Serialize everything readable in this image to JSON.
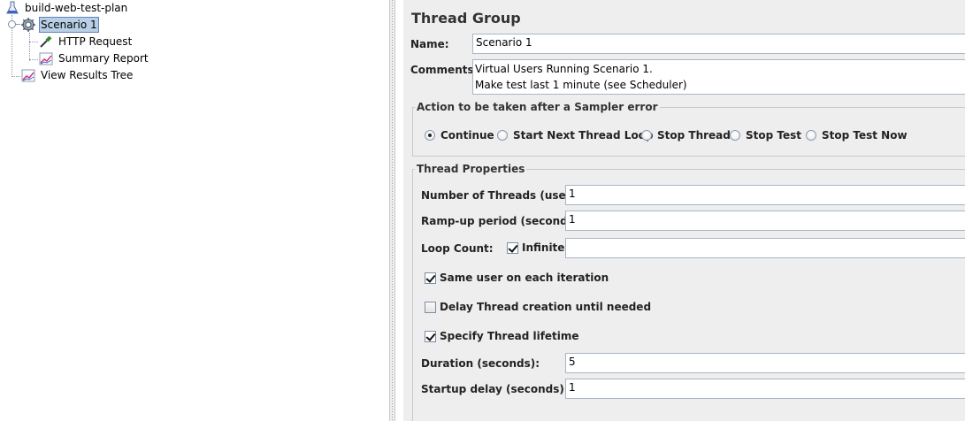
{
  "tree": {
    "root": {
      "label": "build-web-test-plan",
      "icon": "flask-icon"
    },
    "items": [
      {
        "label": "Scenario 1",
        "icon": "gear-icon",
        "selected": true
      },
      {
        "label": "HTTP Request",
        "icon": "pipette-icon"
      },
      {
        "label": "Summary Report",
        "icon": "chart-icon"
      },
      {
        "label": "View Results Tree",
        "icon": "chart-icon"
      }
    ]
  },
  "panel": {
    "title": "Thread Group",
    "name_label": "Name:",
    "name_value": "Scenario 1",
    "comments_label": "Comments:",
    "comments_value": "Virtual Users Running Scenario 1.\nMake test last 1 minute (see Scheduler)",
    "sampler_error": {
      "legend": "Action to be taken after a Sampler error",
      "options": [
        "Continue",
        "Start Next Thread Loop",
        "Stop Thread",
        "Stop Test",
        "Stop Test Now"
      ],
      "selected": "Continue"
    },
    "thread_props": {
      "legend": "Thread Properties",
      "threads_label": "Number of Threads (users):",
      "threads_value": "1",
      "rampup_label": "Ramp-up period (seconds):",
      "rampup_value": "1",
      "loop_label": "Loop Count:",
      "infinite_label": "Infinite",
      "infinite_checked": true,
      "loop_value": "",
      "same_user_label": "Same user on each iteration",
      "same_user_checked": true,
      "delay_label": "Delay Thread creation until needed",
      "delay_checked": false,
      "lifetime_label": "Specify Thread lifetime",
      "lifetime_checked": true,
      "duration_label": "Duration (seconds):",
      "duration_value": "5",
      "startup_label": "Startup delay (seconds):",
      "startup_value": "1"
    }
  },
  "colors": {
    "selection_bg": "#b8cfe5",
    "panel_bg": "#eeeeee"
  }
}
